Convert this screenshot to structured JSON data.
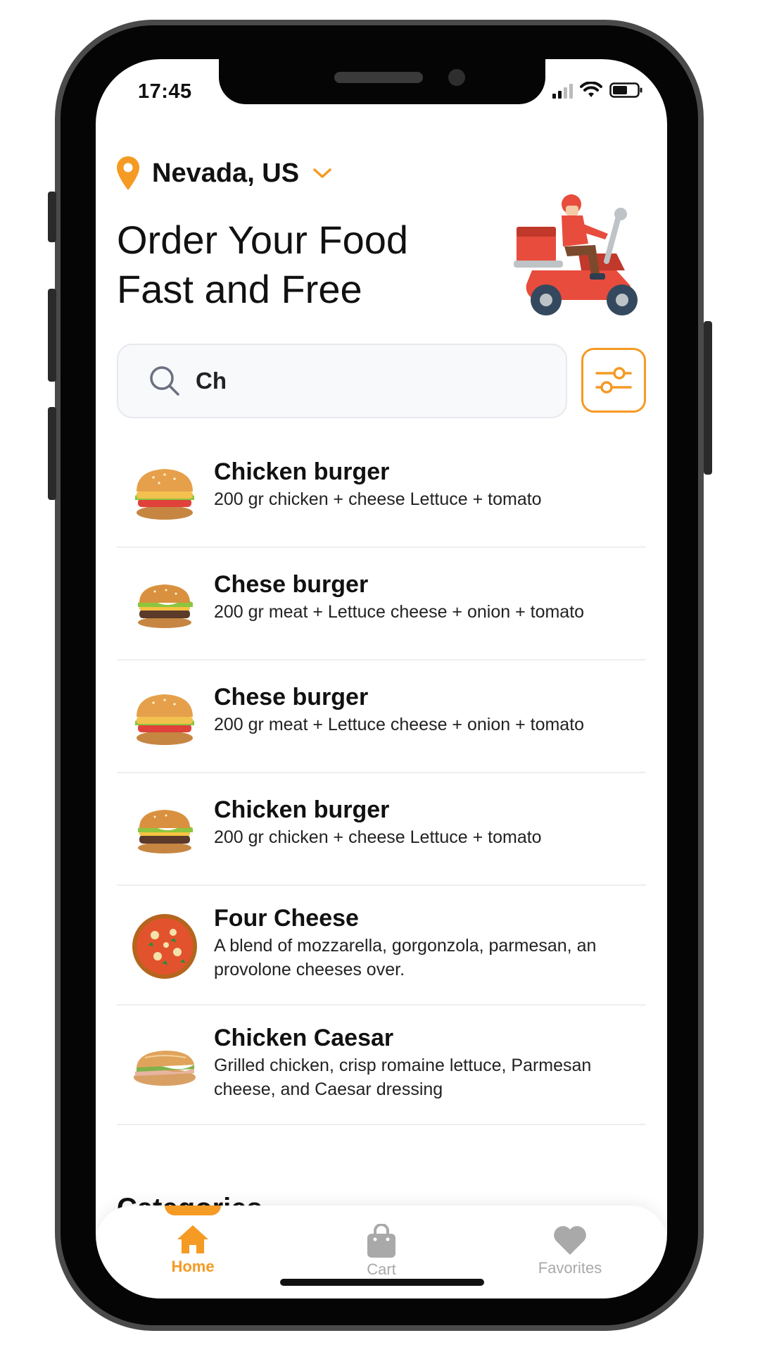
{
  "status_bar": {
    "time": "17:45"
  },
  "location": {
    "label": "Nevada, US"
  },
  "headline": {
    "line1": "Order Your Food",
    "line2": "Fast and Free"
  },
  "search": {
    "value": "Ch"
  },
  "results": [
    {
      "title": "Chicken burger",
      "desc": "200 gr chicken + cheese  Lettuce + tomato",
      "image": "chicken-burger"
    },
    {
      "title": "Chese burger",
      "desc": "200 gr meat + Lettuce cheese + onion + tomato",
      "image": "cheese-burger"
    },
    {
      "title": "Chese burger",
      "desc": "200 gr meat + Lettuce cheese + onion + tomato",
      "image": "chicken-burger"
    },
    {
      "title": "Chicken burger",
      "desc": "200 gr chicken + cheese  Lettuce + tomato",
      "image": "cheese-burger"
    },
    {
      "title": "Four Cheese",
      "desc": "A blend of mozzarella, gorgonzola, parmesan, an provolone cheeses over.",
      "image": "pizza"
    },
    {
      "title": "Chicken Caesar",
      "desc": "Grilled chicken, crisp romaine lettuce, Parmesan cheese, and Caesar dressing",
      "image": "sandwich"
    }
  ],
  "section": {
    "categories": "Categories"
  },
  "tabs": [
    {
      "label": "Home",
      "icon": "home-icon",
      "active": true
    },
    {
      "label": "Cart",
      "icon": "bag-icon",
      "active": false
    },
    {
      "label": "Favorites",
      "icon": "heart-icon",
      "active": false
    }
  ],
  "colors": {
    "accent": "#f59a23",
    "inactive": "#a9a9a9",
    "text": "#111111"
  }
}
